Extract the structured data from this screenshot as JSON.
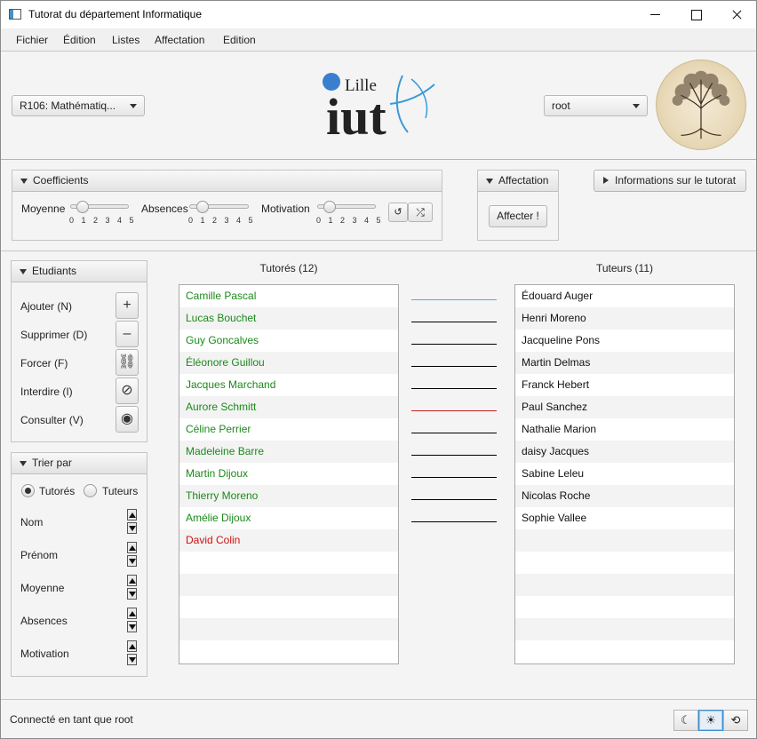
{
  "window": {
    "title": "Tutorat du département Informatique"
  },
  "menu": [
    "Fichier",
    "Édition",
    "Listes",
    "Affectation",
    "Edition"
  ],
  "header": {
    "subject_select": "R106: Mathématiq...",
    "user_select": "root",
    "logo_text": "Lille",
    "logo_iut": "iut"
  },
  "coefficients": {
    "title": "Coefficients",
    "sliders": [
      {
        "label": "Moyenne",
        "value": 0
      },
      {
        "label": "Absences",
        "value": 0
      },
      {
        "label": "Motivation",
        "value": 0
      }
    ],
    "ticks": "0 1 2 3 4 5",
    "reset_icon": "reset-icon",
    "shuffle_icon": "shuffle-icon"
  },
  "affectation": {
    "title": "Affectation",
    "button": "Affecter !"
  },
  "info": {
    "title": "Informations sur le tutorat"
  },
  "etudiants": {
    "title": "Etudiants",
    "actions": [
      {
        "label": "Ajouter (N)",
        "icon": "plus-icon",
        "glyph": "+"
      },
      {
        "label": "Supprimer (D)",
        "icon": "minus-icon",
        "glyph": "–"
      },
      {
        "label": "Forcer (F)",
        "icon": "link-icon",
        "glyph": "⛓"
      },
      {
        "label": "Interdire (I)",
        "icon": "forbid-icon",
        "glyph": "⊘"
      },
      {
        "label": "Consulter (V)",
        "icon": "eye-icon",
        "glyph": "◉"
      }
    ]
  },
  "trier": {
    "title": "Trier par",
    "radio_tutores": "Tutorés",
    "radio_tuteurs": "Tuteurs",
    "selected": "Tutorés",
    "criteria": [
      "Nom",
      "Prénom",
      "Moyenne",
      "Absences",
      "Motivation"
    ]
  },
  "tutores": {
    "header": "Tutorés (12)",
    "items": [
      {
        "name": "Camille Pascal",
        "color": "#1a8a1a"
      },
      {
        "name": "Lucas Bouchet",
        "color": "#1a8a1a"
      },
      {
        "name": "Guy Goncalves",
        "color": "#1a8a1a"
      },
      {
        "name": "Éléonore Guillou",
        "color": "#1a8a1a"
      },
      {
        "name": "Jacques Marchand",
        "color": "#1a8a1a"
      },
      {
        "name": "Aurore Schmitt",
        "color": "#1a8a1a"
      },
      {
        "name": "Céline Perrier",
        "color": "#1a8a1a"
      },
      {
        "name": "Madeleine Barre",
        "color": "#1a8a1a"
      },
      {
        "name": "Martin Dijoux",
        "color": "#1a8a1a"
      },
      {
        "name": "Thierry Moreno",
        "color": "#1a8a1a"
      },
      {
        "name": "Amélie Dijoux",
        "color": "#1a8a1a"
      },
      {
        "name": "David Colin",
        "color": "#d01010"
      }
    ]
  },
  "tuteurs": {
    "header": "Tuteurs (11)",
    "items": [
      "Édouard Auger",
      "Henri Moreno",
      "Jacqueline Pons",
      "Martin Delmas",
      "Franck Hebert",
      "Paul Sanchez",
      "Nathalie Marion",
      "daisy Jacques",
      "Sabine Leleu",
      "Nicolas Roche",
      "Sophie Vallee"
    ]
  },
  "links": [
    {
      "color": "#22c8d8"
    },
    {
      "color": "#000000"
    },
    {
      "color": "#000000"
    },
    {
      "color": "#000000"
    },
    {
      "color": "#000000"
    },
    {
      "color": "#c81e1e"
    },
    {
      "color": "#000000"
    },
    {
      "color": "#000000"
    },
    {
      "color": "#000000"
    },
    {
      "color": "#000000"
    },
    {
      "color": "#000000"
    }
  ],
  "status": {
    "text": "Connecté en tant que root"
  },
  "theme_buttons": [
    {
      "icon": "moon-icon",
      "glyph": "☾",
      "active": false
    },
    {
      "icon": "sun-icon",
      "glyph": "☀",
      "active": true
    },
    {
      "icon": "auto-theme-icon",
      "glyph": "⟲",
      "active": false
    }
  ]
}
